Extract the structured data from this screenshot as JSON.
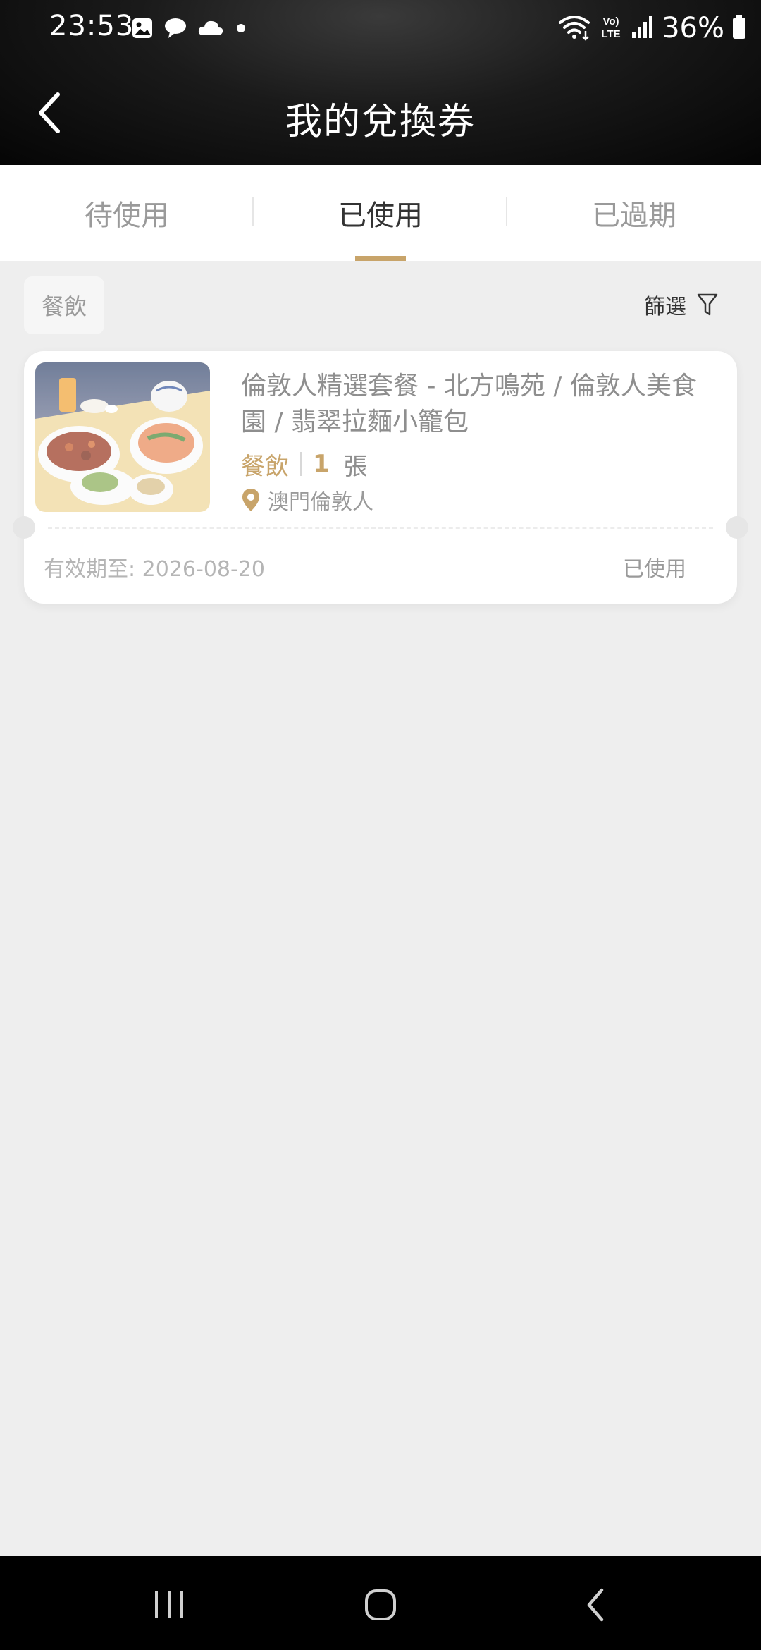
{
  "status_bar": {
    "time": "23:53",
    "battery": "36%",
    "icons_left": [
      "gallery-icon",
      "chat-icon",
      "cloud-icon",
      "dot-icon"
    ],
    "icons_right": [
      "wifi-icon",
      "volte-icon",
      "signal-icon",
      "battery-icon"
    ]
  },
  "header": {
    "title": "我的兌換券"
  },
  "tabs": [
    {
      "label": "待使用",
      "active": false
    },
    {
      "label": "已使用",
      "active": true
    },
    {
      "label": "已過期",
      "active": false
    }
  ],
  "filter": {
    "chip_label": "餐飲",
    "filter_label": "篩選"
  },
  "coupon": {
    "title": "倫敦人精選套餐 - 北方鳴苑 / 倫敦人美食園 / 翡翠拉麵小籠包",
    "category": "餐飲",
    "quantity": "1",
    "unit": "張",
    "location": "澳門倫敦人",
    "validity": "有效期至: 2026-08-20",
    "status": "已使用"
  },
  "colors": {
    "accent": "#c8a46a",
    "header_bg": "#0b0b0b",
    "page_bg": "#eeeeee"
  }
}
